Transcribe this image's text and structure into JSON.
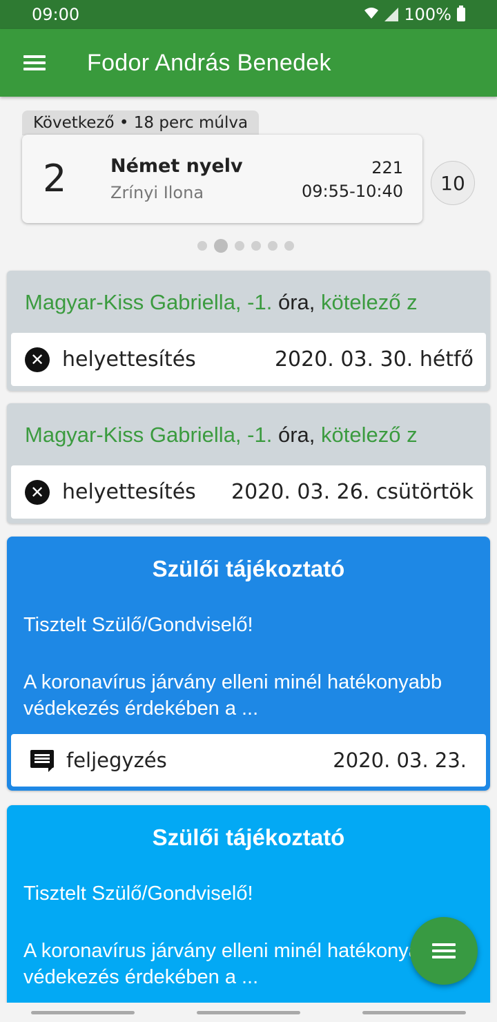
{
  "status_bar": {
    "time": "09:00",
    "battery": "100%"
  },
  "app_bar": {
    "title": "Fodor András Benedek",
    "menu_icon": "hamburger-menu-icon"
  },
  "next_lesson": {
    "tag": "Következő • 18 perc múlva",
    "number": "2",
    "subject": "Német nyelv",
    "teacher": "Zrínyi Ilona",
    "room": "221",
    "time": "09:55-10:40",
    "side_count": "10"
  },
  "pager": {
    "pages": 6,
    "active": 2
  },
  "substitutions": [
    {
      "teacher": "Magyar-Kiss Gabriella,",
      "lesson_num": "-1.",
      "lesson_word": "óra,",
      "kind": "kötelező z",
      "label": "helyettesítés",
      "date": "2020. 03. 30. hétfő",
      "icon": "cancel-circle-icon"
    },
    {
      "teacher": "Magyar-Kiss Gabriella,",
      "lesson_num": "-1.",
      "lesson_word": "óra,",
      "kind": "kötelező z",
      "label": "helyettesítés",
      "date": "2020. 03. 26. csütörtök",
      "icon": "cancel-circle-icon"
    }
  ],
  "notices": [
    {
      "title": "Szülői tájékoztató",
      "greeting": "Tisztelt Szülő/Gondviselő!",
      "body": "A koronavírus járvány elleni minél hatékonyabb védekezés érdekében a ...",
      "type_label": "feljegyzés",
      "date": "2020. 03. 23.",
      "color": "#1e88e5",
      "icon": "comment-note-icon"
    },
    {
      "title": "Szülői tájékoztató",
      "greeting": "Tisztelt Szülő/Gondviselő!",
      "body": "A koronavírus járvány elleni minél hatékonyabb védekezés érdekében a ...",
      "color": "#03a9f4"
    }
  ],
  "colors": {
    "status_bar": "#2e7a32",
    "app_bar": "#399a3c",
    "accent_green": "#3b9b3f",
    "fab": "#389a42"
  }
}
